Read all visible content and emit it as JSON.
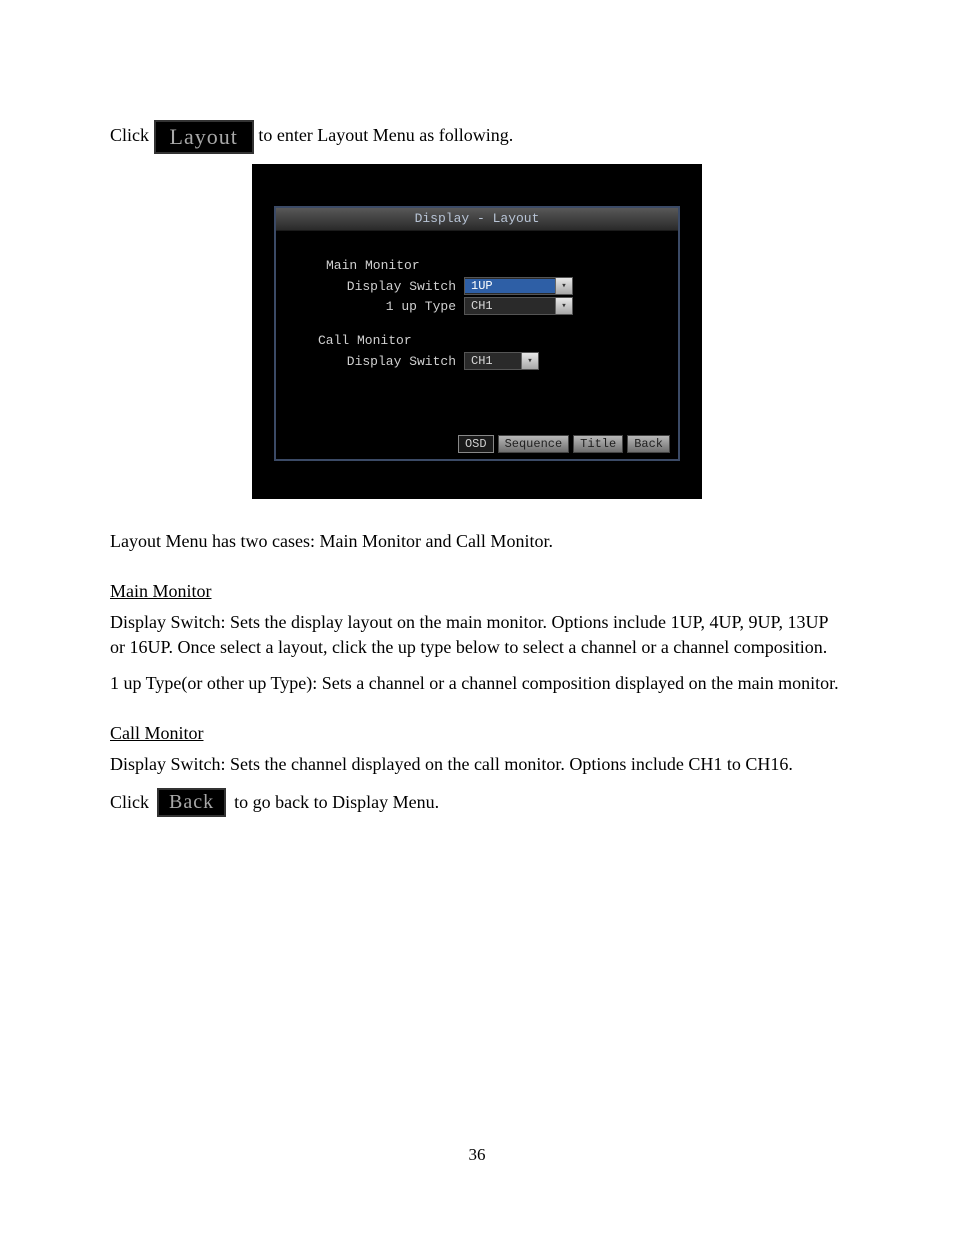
{
  "intro": {
    "pre_text": "Click ",
    "button_label": "Layout",
    "post_text": " to enter Layout Menu as following."
  },
  "screenshot": {
    "title": "Display - Layout",
    "main_monitor": {
      "heading": "Main Monitor",
      "display_switch_label": "Display Switch",
      "display_switch_value": "1UP",
      "one_up_type_label": "1 up Type",
      "one_up_type_value": "CH1"
    },
    "call_monitor": {
      "heading": "Call Monitor",
      "display_switch_label": "Display Switch",
      "display_switch_value": "CH1"
    },
    "footer_buttons": [
      "OSD",
      "Sequence",
      "Title",
      "Back"
    ]
  },
  "body": {
    "layout_para": "Layout Menu has two cases: Main Monitor and Call Monitor.",
    "main_monitor_head": "Main Monitor",
    "main_display_switch_para": "Display Switch: Sets the display layout on the main monitor. Options include 1UP, 4UP, 9UP, 13UP or 16UP. Once select a layout, click the up type below to select a channel or a channel composition.",
    "main_1up_type_para": "1 up Type(or other up Type): Sets a channel or a channel composition displayed on the main monitor.",
    "call_monitor_head": "Call Monitor",
    "call_display_switch_para": "Display Switch: Sets the channel displayed on the call monitor. Options include CH1 to CH16.",
    "back_pre_text": "Click ",
    "back_button_label": "Back",
    "back_post_text": " to go back to Display Menu.",
    "page_number": "36"
  }
}
